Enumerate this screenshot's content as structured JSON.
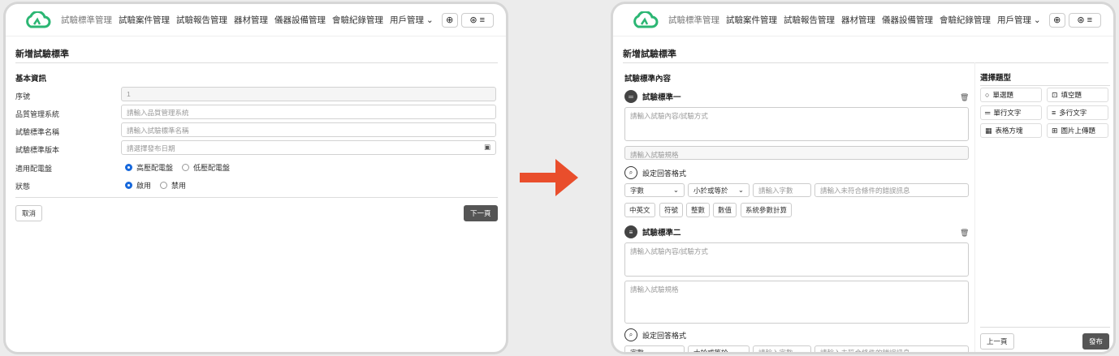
{
  "nav": {
    "items": [
      "試驗標準管理",
      "試驗案件管理",
      "試驗報告管理",
      "器材管理",
      "儀器設備管理",
      "會驗紀錄管理"
    ],
    "user_menu": "用戶管理",
    "icons": [
      "logo-cloud-icon",
      "globe-icon",
      "user-circle-icon",
      "menu-icon"
    ]
  },
  "left": {
    "title": "新增試驗標準",
    "section": "基本資訊",
    "fields": [
      {
        "label": "序號",
        "value": "1"
      },
      {
        "label": "品質管理系統",
        "placeholder": "請輸入品質管理系統"
      },
      {
        "label": "試驗標準名稱",
        "placeholder": "請輸入試驗標準名稱"
      },
      {
        "label": "試驗標準版本",
        "placeholder": "請選擇發布日期"
      }
    ],
    "panel_label": "適用配電盤",
    "panel_options": [
      "高壓配電盤",
      "低壓配電盤"
    ],
    "status_label": "狀態",
    "status_options": [
      "啟用",
      "禁用"
    ],
    "cancel": "取消",
    "next": "下一頁"
  },
  "right": {
    "title": "新增試驗標準",
    "content_title": "試驗標準內容",
    "block1": {
      "title": "試驗標準一",
      "content_ph": "請輸入試驗內容/試驗方式",
      "spec_ph": "請輸入試驗規格"
    },
    "answer_format": "設定回答格式",
    "format": {
      "type": "字數",
      "op": "小於或等於",
      "num_ph": "請輸入字數",
      "err_ph": "請輸入未符合條件的錯誤訊息"
    },
    "chips": [
      "中英文",
      "符號",
      "整數",
      "數值",
      "系統參數計算"
    ],
    "block2": {
      "title": "試驗標準二",
      "content_ph": "請輸入試驗內容/試驗方式",
      "spec_ph": "請輸入試驗規格"
    },
    "answer_format2": "設定回答格式",
    "format2": {
      "type": "字數",
      "op": "大於或等於",
      "num_ph": "請輸入字數",
      "err_ph": "請輸入未符合條件的錯誤訊息"
    },
    "side_title": "選擇題型",
    "qtypes": [
      "單選題",
      "填空題",
      "單行文字",
      "多行文字",
      "表格方塊",
      "圖片上傳題"
    ],
    "prev": "上一頁",
    "publish": "發布"
  },
  "colors": {
    "accent": "#1668dc",
    "arrow": "#e94e2c",
    "logo": "#2bb673"
  }
}
